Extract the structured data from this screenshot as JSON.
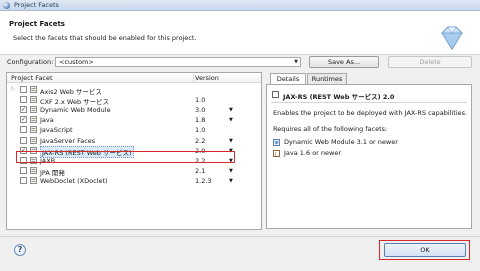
{
  "window": {
    "title": "Project Facets"
  },
  "header": {
    "title": "Project Facets",
    "description": "Select the facets that should be enabled for this project."
  },
  "config": {
    "label": "Configuration:",
    "value": "<custom>",
    "save_as": "Save As...",
    "delete": "Delete"
  },
  "facets": {
    "col_facet": "Project Facet",
    "col_version": "Version",
    "rows": [
      {
        "label": "Axis2 Web サービス",
        "version": "",
        "checked": false,
        "has_dd": false,
        "expander": true
      },
      {
        "label": "CXF 2.x Web サービス",
        "version": "1.0",
        "checked": false,
        "has_dd": false,
        "expander": false
      },
      {
        "label": "Dynamic Web Module",
        "version": "3.0",
        "checked": true,
        "has_dd": true,
        "expander": false
      },
      {
        "label": "Java",
        "version": "1.8",
        "checked": true,
        "has_dd": true,
        "expander": false
      },
      {
        "label": "JavaScript",
        "version": "1.0",
        "checked": false,
        "has_dd": false,
        "expander": false
      },
      {
        "label": "JavaServer Faces",
        "version": "2.2",
        "checked": false,
        "has_dd": true,
        "expander": false
      },
      {
        "label": "JAX-RS (REST Web サービス)",
        "version": "2.0",
        "checked": true,
        "has_dd": true,
        "expander": false,
        "selected": true
      },
      {
        "label": "JAXB",
        "version": "2.2",
        "checked": false,
        "has_dd": true,
        "expander": false
      },
      {
        "label": "JPA 開発",
        "version": "2.1",
        "checked": false,
        "has_dd": true,
        "expander": false
      },
      {
        "label": "WebDoclet (XDoclet)",
        "version": "1.2.3",
        "checked": false,
        "has_dd": true,
        "expander": false
      }
    ]
  },
  "details": {
    "tab_details": "Details",
    "tab_runtimes": "Runtimes",
    "title": "JAX-RS (REST Web サービス) 2.0",
    "description": "Enables the project to be deployed with JAX-RS capabilities.",
    "requires": "Requires all of the following facets:",
    "req_items": [
      "Dynamic Web Module 3.1 or newer",
      "Java 1.6 or newer"
    ]
  },
  "footer": {
    "help": "?",
    "ok": "OK"
  },
  "colors": {
    "highlight": "#d42a2a",
    "selection": "#dbe9f8"
  }
}
